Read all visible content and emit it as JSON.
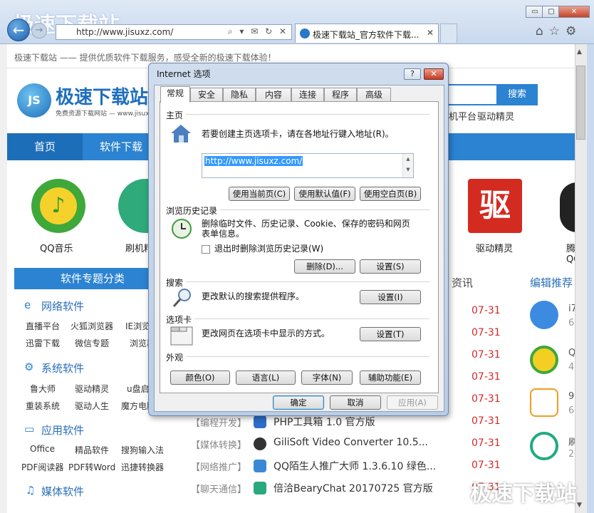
{
  "browser": {
    "address_url": "http://www.jisuxz.com/",
    "address_icons": "⌕ ▾ ✉ ↻ ✕",
    "tab_title": "极速下载站_官方软件下载...",
    "tab_close": "✕",
    "window_buttons": {
      "minimize": "▭",
      "maximize": "▢",
      "close": "✕"
    },
    "right_icons": "⌂☆⚙",
    "back_glyph": "←",
    "forward_glyph": "→",
    "watermark": "极速下载站"
  },
  "page": {
    "notice": "极速下载站 —— 提供优质软件下载服务，感受全新的极速下载体验！",
    "logo_badge": "JS",
    "logo_text": "极速下载站",
    "logo_sub": "免费资源下载网站 — www.jisuxz.com",
    "search_button": "搜索",
    "hot_links": [
      "机平台",
      "驱动精灵"
    ],
    "nav": [
      "首页",
      "软件下载"
    ],
    "featured": [
      {
        "label": "QQ音乐",
        "glyph": "♪"
      },
      {
        "label": "刷机精灵",
        "glyph": ""
      },
      {
        "label": "驱动精灵",
        "glyph": "驱"
      },
      {
        "label": "腾讯QQ",
        "glyph": ""
      }
    ],
    "category_bar": "软件专题分类",
    "sections": [
      {
        "title": "网络软件",
        "icon": "e",
        "links": [
          [
            "直播平台",
            "火狐浏览器",
            "IE浏览器"
          ],
          [
            "迅雷下载",
            "微信专题",
            "浏览器"
          ]
        ]
      },
      {
        "title": "系统软件",
        "icon": "⚙",
        "links": [
          [
            "鲁大师",
            "驱动精灵",
            "u盘启动"
          ],
          [
            "重装系统",
            "驱动人生",
            "魔方电脑"
          ]
        ]
      },
      {
        "title": "应用软件",
        "icon": "▭",
        "links": [
          [
            "Office",
            "精品软件",
            "搜狗输入法"
          ],
          [
            "PDF阅读器",
            "PDF转Word",
            "迅捷转换器"
          ]
        ]
      },
      {
        "title": "媒体软件",
        "icon": "♫",
        "links": []
      }
    ],
    "news_tab": "资讯",
    "edit_tab": "编辑推荐",
    "dates": [
      "07-31",
      "07-31",
      "07-31",
      "07-31",
      "07-31",
      "07-31",
      "07-31",
      "07-31",
      "07-31"
    ],
    "rows": [
      {
        "cat": "【编程开发】",
        "title": "PHP工具箱 1.0 官方版"
      },
      {
        "cat": "【媒体转换】",
        "title": "GiliSoft Video Converter 10.5..."
      },
      {
        "cat": "【网络推广】",
        "title": "QQ陌生人推广大师 1.3.6.10 绿色..."
      },
      {
        "cat": "【聊天通信】",
        "title": "倍洽BearyChat 20170725 官方版"
      }
    ],
    "side_items": [
      {
        "t": "i7",
        "s": "6"
      },
      {
        "t": "Q",
        "s": "4"
      },
      {
        "t": "9",
        "s": "6"
      },
      {
        "t": "刷",
        "s": "2"
      }
    ],
    "scroll_up": "▲",
    "scroll_down": "▼"
  },
  "dialog": {
    "title": "Internet 选项",
    "help": "?",
    "close": "✕",
    "tabs": [
      "常规",
      "安全",
      "隐私",
      "内容",
      "连接",
      "程序",
      "高级"
    ],
    "homepage": {
      "group": "主页",
      "desc": "若要创建主页选项卡，请在各地址行键入地址(R)。",
      "url": "http://www.jisuxz.com/",
      "buttons": [
        "使用当前页(C)",
        "使用默认值(F)",
        "使用空白页(B)"
      ]
    },
    "history": {
      "group": "浏览历史记录",
      "desc_line1": "删除临时文件、历史记录、Cookie、保存的密码和网页",
      "desc_line2": "表单信息。",
      "checkbox": "退出时删除浏览历史记录(W)",
      "buttons": [
        "删除(D)...",
        "设置(S)"
      ]
    },
    "search": {
      "group": "搜索",
      "desc": "更改默认的搜索提供程序。",
      "button": "设置(I)"
    },
    "tabs_group": {
      "group": "选项卡",
      "desc": "更改网页在选项卡中显示的方式。",
      "button": "设置(T)"
    },
    "appearance": {
      "group": "外观",
      "buttons": [
        "颜色(O)",
        "语言(L)",
        "字体(N)",
        "辅助功能(E)"
      ]
    },
    "footer": {
      "ok": "确定",
      "cancel": "取消",
      "apply": "应用(A)"
    }
  }
}
